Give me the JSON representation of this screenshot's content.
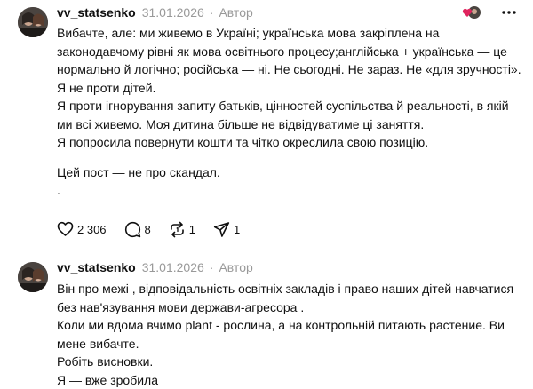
{
  "posts": [
    {
      "username": "vv_statsenko",
      "date": "31.01.2026",
      "separator": "·",
      "badge": "Автор",
      "paragraphs": [
        "Вибачте, але: ми живемо в Україні; українська мова закріплена на законодавчому рівні як мова освітнього процесу;англійська + українська — це нормально й логічно; російська — ні. Не сьогодні. Не зараз. Не «для зручності».",
        "Я не проти дітей.",
        "Я проти ігнорування запиту батьків, цінностей суспільства й реальності, в якій ми всі живемо. Моя дитина більше не відвідуватиме ці заняття.",
        "Я попросила повернути кошти та чітко окреслила свою позицію.",
        "Цей пост — не про скандал.",
        "."
      ],
      "actions": {
        "likes": "2 306",
        "comments": "8",
        "reposts": "1",
        "shares": "1"
      },
      "icons": [
        "heart-icon",
        "comment-icon",
        "repost-icon",
        "share-icon",
        "more-icon",
        "heart-avatar-badge-icon"
      ],
      "accent_color": "#e0245e"
    },
    {
      "username": "vv_statsenko",
      "date": "31.01.2026",
      "separator": "·",
      "badge": "Автор",
      "paragraphs": [
        "Він про межі , відповідальність освітніх закладів і право наших дітей навчатися без нав'язування мови держави-агресора .",
        "Коли ми вдома вчимо plant - рослина, а на контрольній питають растение. Ви мене вибачте.",
        "Робіть висновки.",
        "Я — вже зробила"
      ]
    }
  ]
}
